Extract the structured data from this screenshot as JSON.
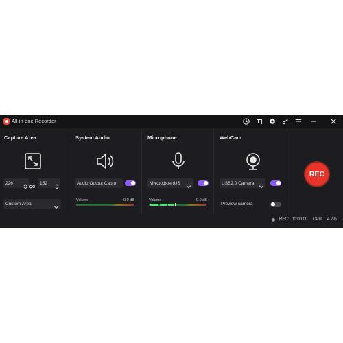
{
  "app": {
    "title": "All-in-one Recorder"
  },
  "titlebar": {
    "icons": [
      "clock-icon",
      "crop-icon",
      "gear-icon",
      "key-icon",
      "menu-icon",
      "minimize-icon",
      "close-icon"
    ]
  },
  "capture": {
    "title": "Capture Area",
    "width": "226",
    "height": "152",
    "mode": "Custom Area"
  },
  "system_audio": {
    "title": "System Audio",
    "device": "Audio Output Captu",
    "enabled": true,
    "volume_label": "Volume",
    "volume_db": "0.0 dB"
  },
  "microphone": {
    "title": "Microphone",
    "device": "Микрофон (US",
    "enabled": true,
    "volume_label": "Volume",
    "volume_db": "0.0 dB"
  },
  "webcam": {
    "title": "WebCam",
    "device": "USB2.0 Camera",
    "enabled": true,
    "preview_label": "Preview camera",
    "preview_enabled": false
  },
  "record": {
    "label": "REC"
  },
  "status": {
    "rec_label": "REC:",
    "rec_time": "00:00:00",
    "cpu_label": "CPU:",
    "cpu_value": "4.7%"
  },
  "colors": {
    "accent": "#8b5cf6",
    "rec": "#e8342a",
    "background": "#1d1d21"
  }
}
